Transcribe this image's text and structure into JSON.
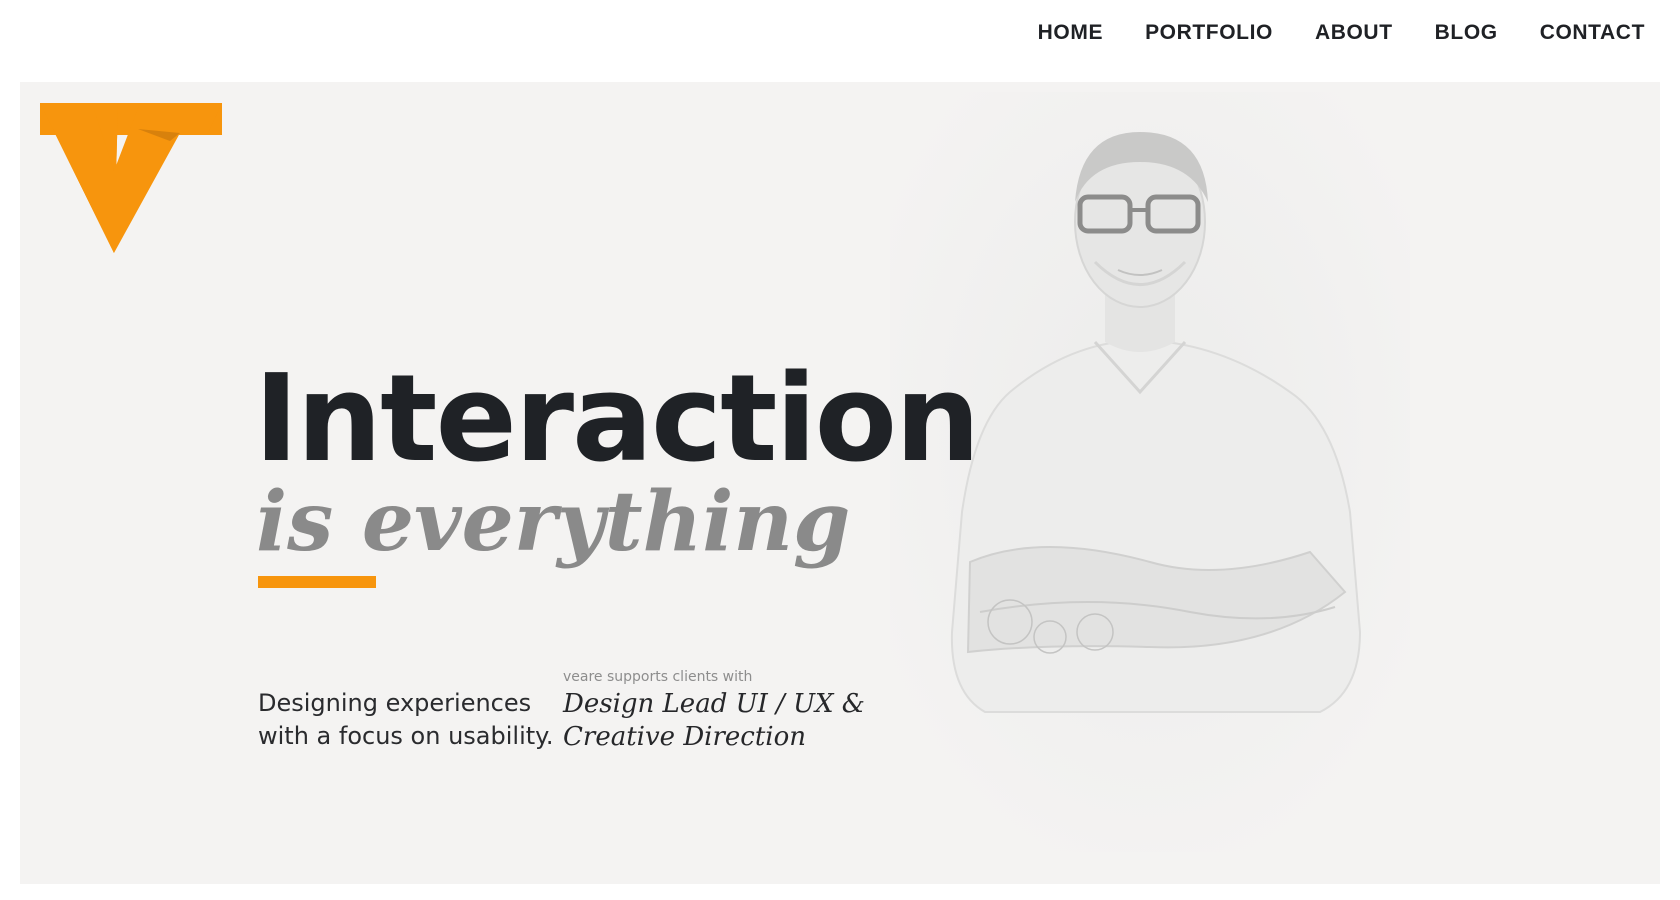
{
  "nav": {
    "items": [
      {
        "label": "HOME"
      },
      {
        "label": "PORTFOLIO"
      },
      {
        "label": "ABOUT"
      },
      {
        "label": "BLOG"
      },
      {
        "label": "CONTACT"
      }
    ]
  },
  "hero": {
    "headline": "Interaction",
    "subheadline": "is everything",
    "tagline": {
      "line1": "Designing experiences",
      "line2": "with a focus on usability."
    },
    "support_intro": "veare supports clients with",
    "services": {
      "line1": "Design Lead UI / UX &",
      "line2": "Creative Direction"
    }
  },
  "colors": {
    "accent": "#f7950d",
    "accent_dark": "#d8810c",
    "hero_background": "#f4f3f2",
    "text_dark": "#1f2226",
    "text_muted": "#8a8a8a"
  },
  "icons": {
    "logo": "veare-logo-triangle",
    "portrait": "person-portrait-photo"
  }
}
